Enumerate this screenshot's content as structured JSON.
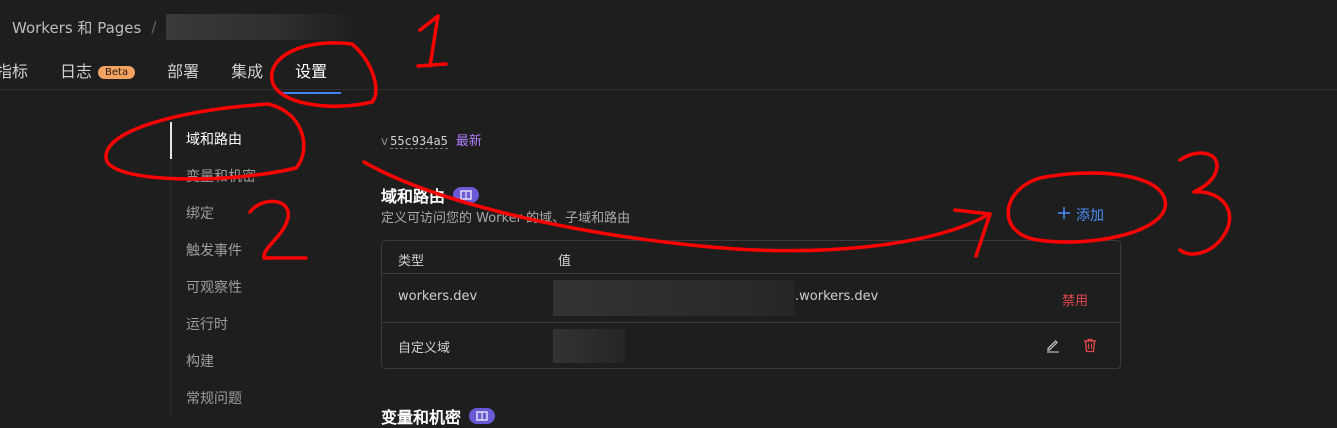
{
  "breadcrumb": {
    "root": "Workers 和 Pages",
    "separator": "/"
  },
  "tabs": [
    {
      "label": "指标"
    },
    {
      "label": "日志",
      "badge": "Beta"
    },
    {
      "label": "部署"
    },
    {
      "label": "集成"
    },
    {
      "label": "设置",
      "active": true
    }
  ],
  "sidenav": [
    {
      "label": "域和路由",
      "active": true
    },
    {
      "label": "变量和机密"
    },
    {
      "label": "绑定"
    },
    {
      "label": "触发事件"
    },
    {
      "label": "可观察性"
    },
    {
      "label": "运行时"
    },
    {
      "label": "构建"
    },
    {
      "label": "常规问题"
    }
  ],
  "version": {
    "prefix": "v",
    "hash": "55c934a5",
    "status": "最新"
  },
  "domains": {
    "title": "域和路由",
    "subtitle": "定义可访问您的 Worker 的域、子域和路由",
    "add_label": "添加",
    "columns": {
      "type": "类型",
      "value": "值"
    },
    "rows": [
      {
        "type": "workers.dev",
        "value_suffix": ".workers.dev",
        "action": "禁用"
      },
      {
        "type": "自定义域"
      }
    ]
  },
  "vars": {
    "title": "变量和机密"
  },
  "annotations": [
    "1",
    "2",
    "3"
  ],
  "colors": {
    "accent": "#3b82f6",
    "danger": "#e5484d",
    "annotation": "#ff0000",
    "badge": "#f4a261"
  }
}
